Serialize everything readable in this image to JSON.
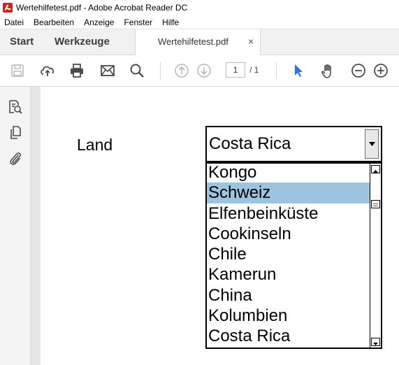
{
  "window": {
    "title": "Wertehilfetest.pdf - Adobe Acrobat Reader DC"
  },
  "menu": {
    "items": [
      "Datei",
      "Bearbeiten",
      "Anzeige",
      "Fenster",
      "Hilfe"
    ]
  },
  "tabs": {
    "start": "Start",
    "tools": "Werkzeuge",
    "document": "Wertehilfetest.pdf",
    "close_glyph": "×"
  },
  "toolbar": {
    "icons": [
      "save-icon",
      "upload-cloud-icon",
      "print-icon",
      "mail-icon",
      "search-icon",
      "page-up-icon",
      "page-down-icon",
      "select-cursor-icon",
      "hand-icon",
      "zoom-out-icon",
      "zoom-in-icon"
    ],
    "current_page": "1",
    "total_pages": "/ 1",
    "accent_color": "#2d6fd6"
  },
  "left_rail": {
    "icons": [
      "export-pdf-icon",
      "pages-icon",
      "attachment-icon"
    ]
  },
  "form": {
    "label": "Land",
    "combo_value": "Costa Rica",
    "options": [
      "Kongo",
      "Schweiz",
      "Elfenbeinküste",
      "Cookinseln",
      "Chile",
      "Kamerun",
      "China",
      "Kolumbien",
      "Costa Rica"
    ],
    "highlighted_option": "Schweiz",
    "highlight_color": "#9dc3df"
  }
}
